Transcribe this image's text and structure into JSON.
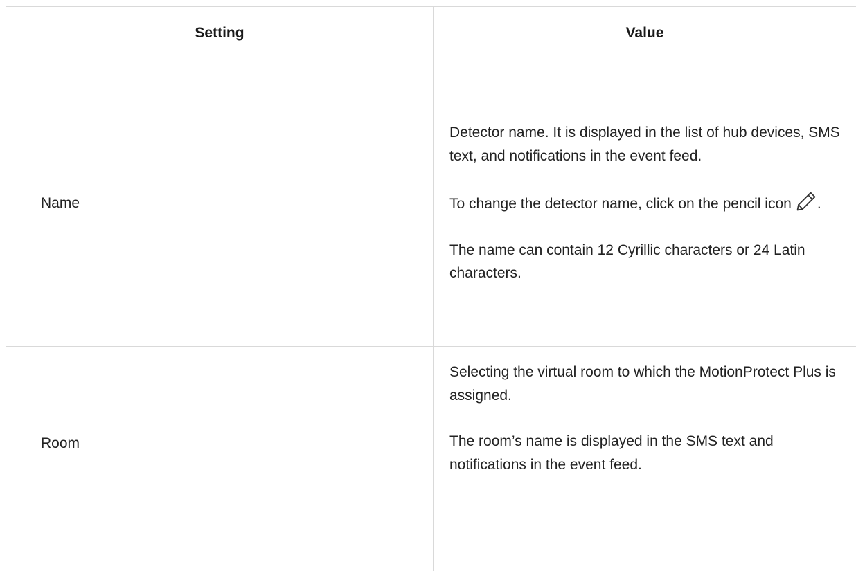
{
  "table": {
    "headers": {
      "setting": "Setting",
      "value": "Value"
    },
    "rows": [
      {
        "setting": "Name",
        "value_paragraphs": [
          "Detector name. It is displayed in the list of hub devices, SMS text, and notifications in the event feed.",
          "To change the detector name, click on the pencil icon",
          "The name can contain 12 Cyrillic characters or 24 Latin characters."
        ],
        "icon": "pencil-icon",
        "icon_suffix": "."
      },
      {
        "setting": "Room",
        "value_paragraphs": [
          "Selecting the virtual room to which the MotionProtect Plus is assigned.",
          "The room’s name is displayed in the SMS text and notifications in the event feed."
        ]
      }
    ]
  }
}
